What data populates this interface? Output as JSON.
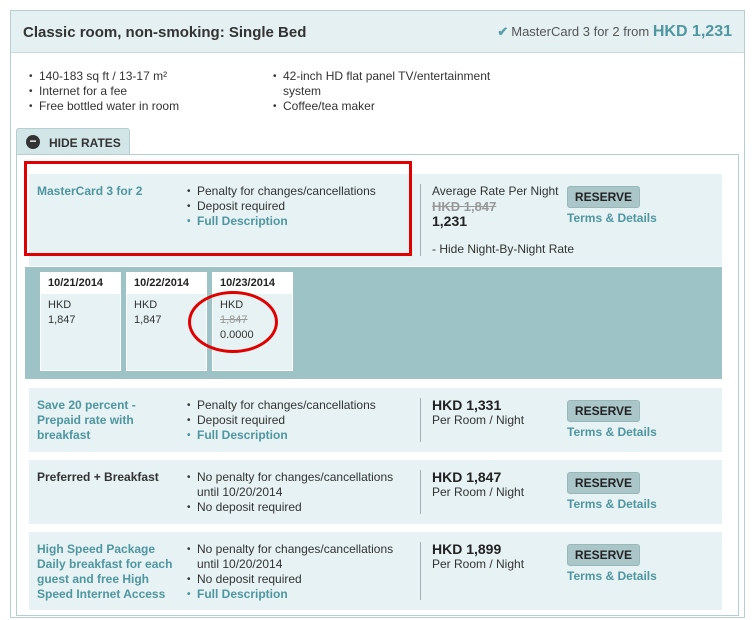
{
  "room": {
    "title": "Classic room, non-smoking: Single Bed",
    "promo_from_text": "MasterCard 3 for 2 from ",
    "promo_from_price": "HKD 1,231",
    "amenities_left": [
      "140-183 sq ft / 13-17 m²",
      "Internet for a fee",
      "Free bottled water in room"
    ],
    "amenities_right": [
      "42-inch HD flat panel TV/entertainment system",
      "Coffee/tea maker"
    ],
    "hide_rates_label": "HIDE RATES"
  },
  "labels": {
    "reserve": "RESERVE",
    "terms": "Terms & Details"
  },
  "rates": [
    {
      "name": "MasterCard 3 for 2",
      "policies": [
        "Penalty for changes/cancellations",
        "Deposit required"
      ],
      "full_description": "Full Description",
      "price_label": "Average Rate Per Night",
      "original_price": "HKD 1,847",
      "price": "1,231",
      "hide_nightly": "- Hide Night-By-Night Rate"
    },
    {
      "name": "Save 20 percent - Prepaid rate with breakfast",
      "policies": [
        "Penalty for changes/cancellations",
        "Deposit required"
      ],
      "full_description": "Full Description",
      "price": "HKD 1,331",
      "per": "Per Room / Night"
    },
    {
      "name": "Preferred + Breakfast",
      "policies": [
        "No penalty for changes/cancellations until 10/20/2014",
        "No deposit required"
      ],
      "price": "HKD 1,847",
      "per": "Per Room / Night"
    },
    {
      "name": "High Speed Package Daily breakfast for each guest and free High Speed Internet Access",
      "policies": [
        "No penalty for changes/cancellations until 10/20/2014",
        "No deposit required"
      ],
      "full_description": "Full Description",
      "price": "HKD 1,899",
      "per": "Per Room / Night"
    }
  ],
  "nightly": [
    {
      "date": "10/21/2014",
      "currency": "HKD",
      "value": "1,847"
    },
    {
      "date": "10/22/2014",
      "currency": "HKD",
      "value": "1,847"
    },
    {
      "date": "10/23/2014",
      "currency": "HKD",
      "value": "1,847",
      "discounted": "0.0000"
    }
  ],
  "colors": {
    "accent": "#4f96a0",
    "highlight": "#e00000",
    "row_bg": "#e6f2f3",
    "nightly_bg": "#9dc3c7"
  }
}
